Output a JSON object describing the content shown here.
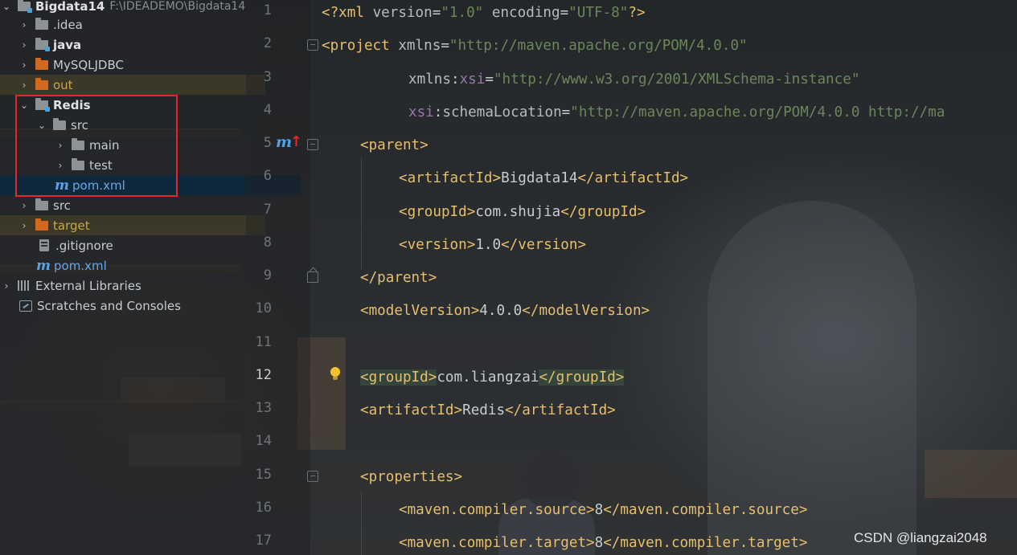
{
  "project_tree": {
    "root": {
      "label": "Bigdata14",
      "path": "F:\\IDEADEMO\\Bigdata14"
    },
    "items": [
      {
        "label": ".idea",
        "kind": "folder",
        "color": "gray",
        "expander": "collapsed"
      },
      {
        "label": "java",
        "kind": "module",
        "bold": true,
        "expander": "collapsed"
      },
      {
        "label": "MySQLJDBC",
        "kind": "folder",
        "color": "orange",
        "expander": "collapsed"
      },
      {
        "label": "out",
        "kind": "folder",
        "color": "orange",
        "expander": "collapsed"
      },
      {
        "label": "Redis",
        "kind": "module",
        "bold": true,
        "expander": "expanded"
      },
      {
        "label": "src",
        "kind": "folder",
        "color": "gray",
        "expander": "expanded"
      },
      {
        "label": "main",
        "kind": "folder",
        "color": "gray",
        "expander": "collapsed"
      },
      {
        "label": "test",
        "kind": "folder",
        "color": "gray",
        "expander": "collapsed"
      },
      {
        "label": "pom.xml",
        "kind": "maven",
        "expander": "none"
      },
      {
        "label": "src",
        "kind": "folder",
        "color": "gray",
        "expander": "collapsed"
      },
      {
        "label": "target",
        "kind": "folder",
        "color": "orange",
        "expander": "collapsed"
      },
      {
        "label": ".gitignore",
        "kind": "file",
        "expander": "none"
      },
      {
        "label": "pom.xml",
        "kind": "maven",
        "expander": "none"
      },
      {
        "label": "External Libraries",
        "kind": "libraries",
        "expander": "collapsed"
      },
      {
        "label": "Scratches and Consoles",
        "kind": "scratches",
        "expander": "none"
      }
    ]
  },
  "editor": {
    "current_line": 12,
    "lines": [
      {
        "n": "1",
        "text": "<?xml version=\"1.0\" encoding=\"UTF-8\"?>"
      },
      {
        "n": "2",
        "text": "<project xmlns=\"http://maven.apache.org/POM/4.0.0\""
      },
      {
        "n": "3",
        "text": "xmlns:xsi=\"http://www.w3.org/2001/XMLSchema-instance\""
      },
      {
        "n": "4",
        "text": "xsi:schemaLocation=\"http://maven.apache.org/POM/4.0.0 http://ma"
      },
      {
        "n": "5",
        "text": "<parent>"
      },
      {
        "n": "6",
        "text": "<artifactId>Bigdata14</artifactId>"
      },
      {
        "n": "7",
        "text": "<groupId>com.shujia</groupId>"
      },
      {
        "n": "8",
        "text": "<version>1.0</version>"
      },
      {
        "n": "9",
        "text": "</parent>"
      },
      {
        "n": "10",
        "text": "<modelVersion>4.0.0</modelVersion>"
      },
      {
        "n": "11",
        "text": ""
      },
      {
        "n": "12",
        "text": "<groupId>com.liangzai</groupId>"
      },
      {
        "n": "13",
        "text": "<artifactId>Redis</artifactId>"
      },
      {
        "n": "14",
        "text": ""
      },
      {
        "n": "15",
        "text": "<properties>"
      },
      {
        "n": "16",
        "text": "<maven.compiler.source>8</maven.compiler.source>"
      },
      {
        "n": "17",
        "text": "<maven.compiler.target>8</maven.compiler.target>"
      }
    ]
  },
  "watermark": "CSDN @liangzai2048",
  "colors": {
    "tag": "#e8bf6a",
    "attr_value": "#6a8759",
    "namespace": "#9876aa",
    "selection": "#0d293e",
    "highlight_box": "#e0282e"
  }
}
